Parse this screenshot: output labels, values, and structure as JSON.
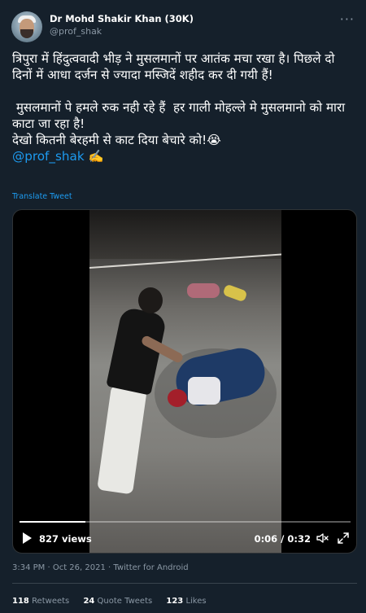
{
  "author": {
    "name": "Dr Mohd Shakir Khan (30K)",
    "handle": "@prof_shak",
    "more_icon": "more-dots-icon"
  },
  "tweet": {
    "line1": "त्रिपुरा में हिंदुत्ववादी भीड़ ने मुसलमानों पर आतंक मचा रखा है। पिछले दो दिनों में आधा दर्जन से ज्यादा मस्जिदें शहीद कर दी गयी हैं!",
    "line2": " मुसलमानों पे हमले रुक नही रहे हैं  हर गाली मोहल्ले मे मुसलमानो को मारा काटा जा रहा है!",
    "line3": "देखो कितनी बेरहमी से काट दिया बेचारे को!😭",
    "mention": "@prof_shak",
    "mention_emoji": "✍️",
    "translate": "Translate Tweet"
  },
  "video": {
    "views": "827 views",
    "time": "0:06 / 0:32",
    "progress": 0.2,
    "play_icon": "play-icon",
    "volume_icon": "volume-muted-icon",
    "fullscreen_icon": "fullscreen-icon"
  },
  "meta": {
    "timestamp": "3:34 PM · Oct 26, 2021 · Twitter for Android"
  },
  "stats": {
    "retweets_count": "118",
    "retweets_label": "Retweets",
    "quotes_count": "24",
    "quotes_label": "Quote Tweets",
    "likes_count": "123",
    "likes_label": "Likes"
  },
  "colors": {
    "background": "#15202b",
    "accent": "#1d9bf0",
    "muted": "#8b98a5"
  }
}
